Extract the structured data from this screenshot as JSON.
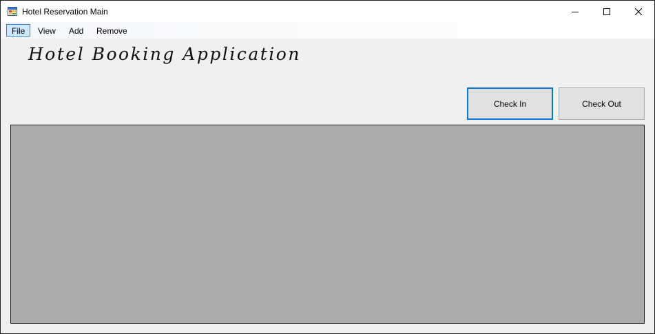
{
  "window": {
    "title": "Hotel Reservation Main",
    "icon": "app-window-icon",
    "controls": [
      "minimize-icon",
      "maximize-icon",
      "close-icon"
    ]
  },
  "menu": {
    "items": [
      {
        "label": "File",
        "active": true
      },
      {
        "label": "View",
        "active": false
      },
      {
        "label": "Add",
        "active": false
      },
      {
        "label": "Remove",
        "active": false
      }
    ]
  },
  "header": {
    "title": "Hotel Booking Application"
  },
  "actions": {
    "check_in_label": "Check In",
    "check_out_label": "Check Out"
  },
  "colors": {
    "panel_background": "#ababab",
    "focus_accent": "#0078d7",
    "menu_highlight": "#cce8ff"
  }
}
